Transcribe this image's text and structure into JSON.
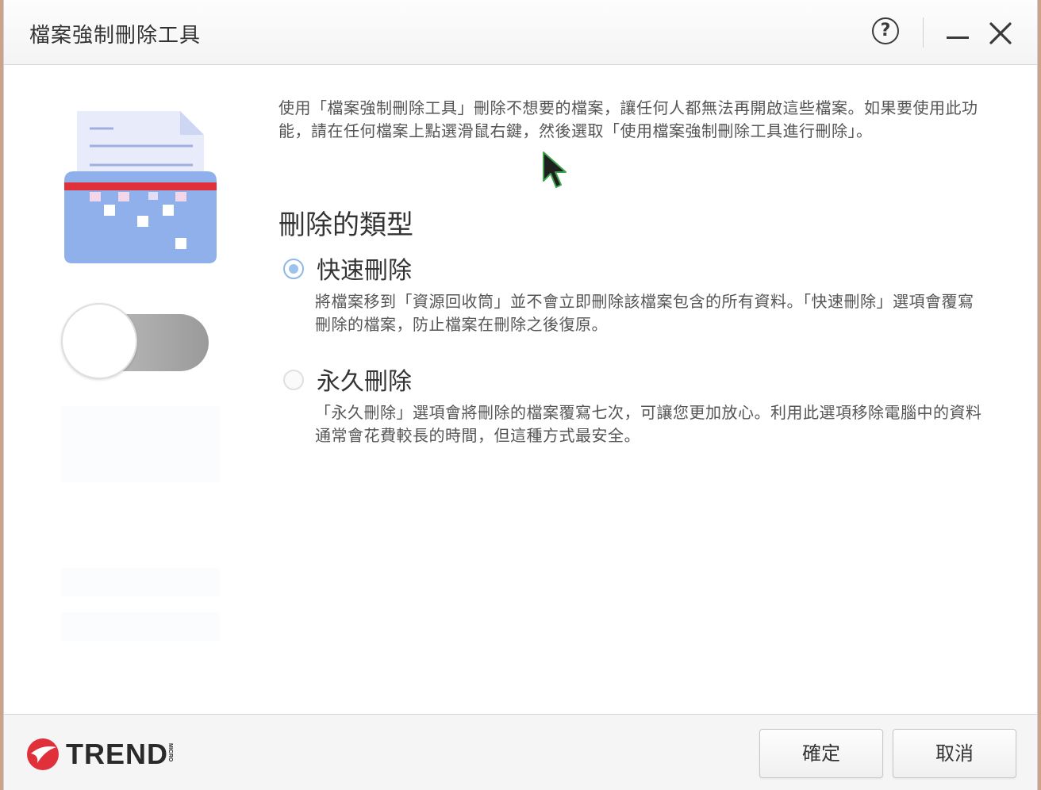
{
  "window": {
    "title": "檔案強制刪除工具",
    "help_icon": "question-circle-icon",
    "help_label": "?",
    "minimize_icon": "minimize-icon",
    "close_icon": "close-icon"
  },
  "sidebar": {
    "illustration_icon": "file-shredder-icon",
    "toggle_icon": "toggle-switch-off"
  },
  "main": {
    "intro": "使用「檔案強制刪除工具」刪除不想要的檔案，讓任何人都無法再開啟這些檔案。如果要使用此功能，請在任何檔案上點選滑鼠右鍵，然後選取「使用檔案強制刪除工具進行刪除」。",
    "section_title": "刪除的類型",
    "options": [
      {
        "label": "快速刪除",
        "selected": true,
        "description": "將檔案移到「資源回收筒」並不會立即刪除該檔案包含的所有資料。「快速刪除」選項會覆寫刪除的檔案，防止檔案在刪除之後復原。"
      },
      {
        "label": "永久刪除",
        "selected": false,
        "description": "「永久刪除」選項會將刪除的檔案覆寫七次，可讓您更加放心。利用此選項移除電腦中的資料通常會花費較長的時間，但這種方式最安全。"
      }
    ]
  },
  "footer": {
    "brand": "TREND",
    "brand_sub": "MICRO",
    "ok_label": "確定",
    "cancel_label": "取消"
  },
  "colors": {
    "accent_red": "#e0313a",
    "radio_blue": "#8fb8ea",
    "illustration_blue": "#8fb0ea"
  }
}
